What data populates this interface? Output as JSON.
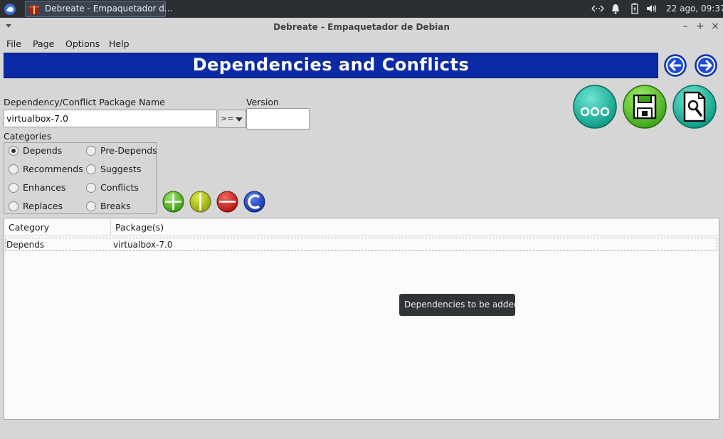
{
  "panel": {
    "task_label": "Debreate - Empaquetador d...",
    "clock": "22 ago, 09:37",
    "tray_icons": [
      "network-icon",
      "notification-bell-icon",
      "battery-icon",
      "volume-icon"
    ]
  },
  "window": {
    "title": "Debreate - Empaquetador de Debian",
    "controls": [
      "minimize",
      "maximize",
      "close"
    ]
  },
  "menubar": {
    "items": [
      "File",
      "Page",
      "Options",
      "Help"
    ]
  },
  "header": {
    "title": "Dependencies and Conflicts",
    "banner_color": "#0c2aa6"
  },
  "form": {
    "package_label": "Dependency/Conflict Package Name",
    "package_value": "virtualbox-7.0",
    "operator_value": ">=",
    "version_label": "Version",
    "version_value": ""
  },
  "categories": {
    "label": "Categories",
    "options": [
      {
        "label": "Depends",
        "selected": true
      },
      {
        "label": "Pre-Depends",
        "selected": false
      },
      {
        "label": "Recommends",
        "selected": false
      },
      {
        "label": "Suggests",
        "selected": false
      },
      {
        "label": "Enhances",
        "selected": false
      },
      {
        "label": "Conflicts",
        "selected": false
      },
      {
        "label": "Replaces",
        "selected": false
      },
      {
        "label": "Breaks",
        "selected": false
      }
    ]
  },
  "list": {
    "columns": [
      "Category",
      "Package(s)"
    ],
    "rows": [
      {
        "category": "Depends",
        "packages": "virtualbox-7.0"
      }
    ]
  },
  "tooltip": "Dependencies to be added",
  "colors": {
    "accent_blue": "#0c2aa6",
    "add_green": "#3ea51a",
    "append_yellow": "#a8b50f",
    "remove_red": "#c21818",
    "clear_blue": "#1c3fb7",
    "teal": "#16b39c"
  }
}
